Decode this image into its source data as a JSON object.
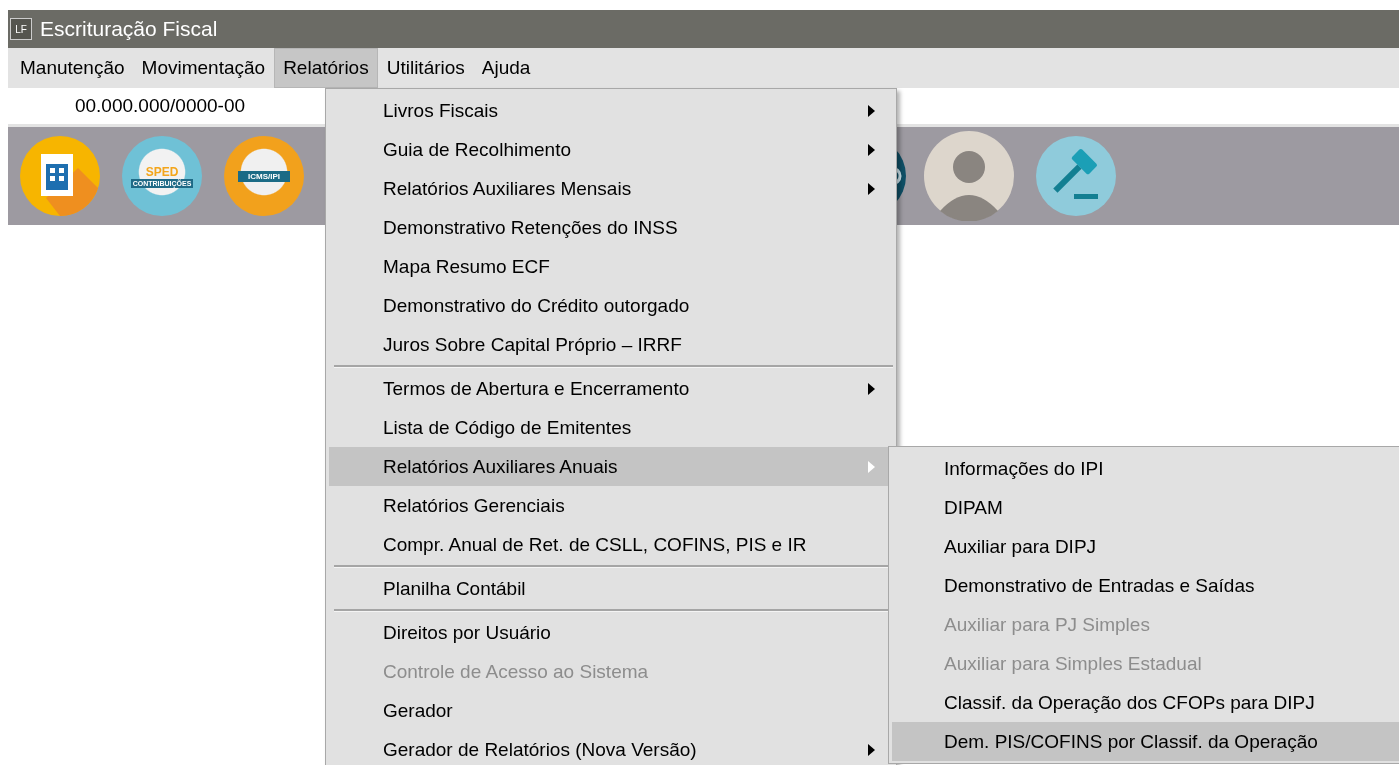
{
  "window": {
    "icon_label": "LF",
    "title": "Escrituração Fiscal"
  },
  "menu_bar": [
    {
      "label": "Manutenção",
      "selected": false
    },
    {
      "label": "Movimentação",
      "selected": false
    },
    {
      "label": "Relatórios",
      "selected": true
    },
    {
      "label": "Utilitários",
      "selected": false
    },
    {
      "label": "Ajuda",
      "selected": false
    }
  ],
  "company_field": {
    "value": "00.000.000/0000-00"
  },
  "toolbar": [
    {
      "kind": "building"
    },
    {
      "kind": "sped",
      "label": "SPED",
      "sublabel": "CONTRIBUIÇÕES"
    },
    {
      "kind": "icms",
      "label": "ICMS/IPI"
    },
    {
      "kind": "dark"
    },
    {
      "kind": "avatar"
    },
    {
      "kind": "gavel"
    }
  ],
  "menu": [
    {
      "kind": "item",
      "label": "Livros Fiscais",
      "submenu": true,
      "disabled": false,
      "selected": false
    },
    {
      "kind": "item",
      "label": "Guia de Recolhimento",
      "submenu": true,
      "disabled": false,
      "selected": false
    },
    {
      "kind": "item",
      "label": "Relatórios Auxiliares Mensais",
      "submenu": true,
      "disabled": false,
      "selected": false
    },
    {
      "kind": "item",
      "label": "Demonstrativo Retenções do INSS",
      "submenu": false,
      "disabled": false,
      "selected": false
    },
    {
      "kind": "item",
      "label": "Mapa Resumo ECF",
      "submenu": false,
      "disabled": false,
      "selected": false
    },
    {
      "kind": "item",
      "label": "Demonstrativo do Crédito outorgado",
      "submenu": false,
      "disabled": false,
      "selected": false
    },
    {
      "kind": "item",
      "label": "Juros Sobre Capital Próprio – IRRF",
      "submenu": false,
      "disabled": false,
      "selected": false
    },
    {
      "kind": "separator"
    },
    {
      "kind": "item",
      "label": "Termos de Abertura e Encerramento",
      "submenu": true,
      "disabled": false,
      "selected": false
    },
    {
      "kind": "item",
      "label": "Lista de Código de Emitentes",
      "submenu": false,
      "disabled": false,
      "selected": false
    },
    {
      "kind": "item",
      "label": "Relatórios Auxiliares Anuais",
      "submenu": true,
      "disabled": false,
      "selected": true
    },
    {
      "kind": "item",
      "label": "Relatórios Gerenciais",
      "submenu": false,
      "disabled": false,
      "selected": false
    },
    {
      "kind": "item",
      "label": "Compr. Anual de Ret. de CSLL, COFINS,  PIS e IR",
      "submenu": false,
      "disabled": false,
      "selected": false
    },
    {
      "kind": "separator"
    },
    {
      "kind": "item",
      "label": "Planilha Contábil",
      "submenu": false,
      "disabled": false,
      "selected": false
    },
    {
      "kind": "separator"
    },
    {
      "kind": "item",
      "label": "Direitos por Usuário",
      "submenu": false,
      "disabled": false,
      "selected": false
    },
    {
      "kind": "item",
      "label": "Controle de Acesso ao Sistema",
      "submenu": false,
      "disabled": true,
      "selected": false
    },
    {
      "kind": "item",
      "label": "Gerador",
      "submenu": false,
      "disabled": false,
      "selected": false
    },
    {
      "kind": "item",
      "label": "Gerador de Relatórios (Nova Versão)",
      "submenu": true,
      "disabled": false,
      "selected": false
    }
  ],
  "submenu": [
    {
      "label": "Informações do IPI",
      "disabled": false,
      "selected": false
    },
    {
      "label": "DIPAM",
      "disabled": false,
      "selected": false
    },
    {
      "label": "Auxiliar para DIPJ",
      "disabled": false,
      "selected": false
    },
    {
      "label": "Demonstrativo de Entradas e Saídas",
      "disabled": false,
      "selected": false
    },
    {
      "label": "Auxiliar para PJ Simples",
      "disabled": true,
      "selected": false
    },
    {
      "label": "Auxiliar para Simples Estadual",
      "disabled": true,
      "selected": false
    },
    {
      "label": "Classif. da Operação dos CFOPs para DIPJ",
      "disabled": false,
      "selected": false
    },
    {
      "label": "Dem. PIS/COFINS por Classif. da Operação",
      "disabled": false,
      "selected": true
    }
  ]
}
